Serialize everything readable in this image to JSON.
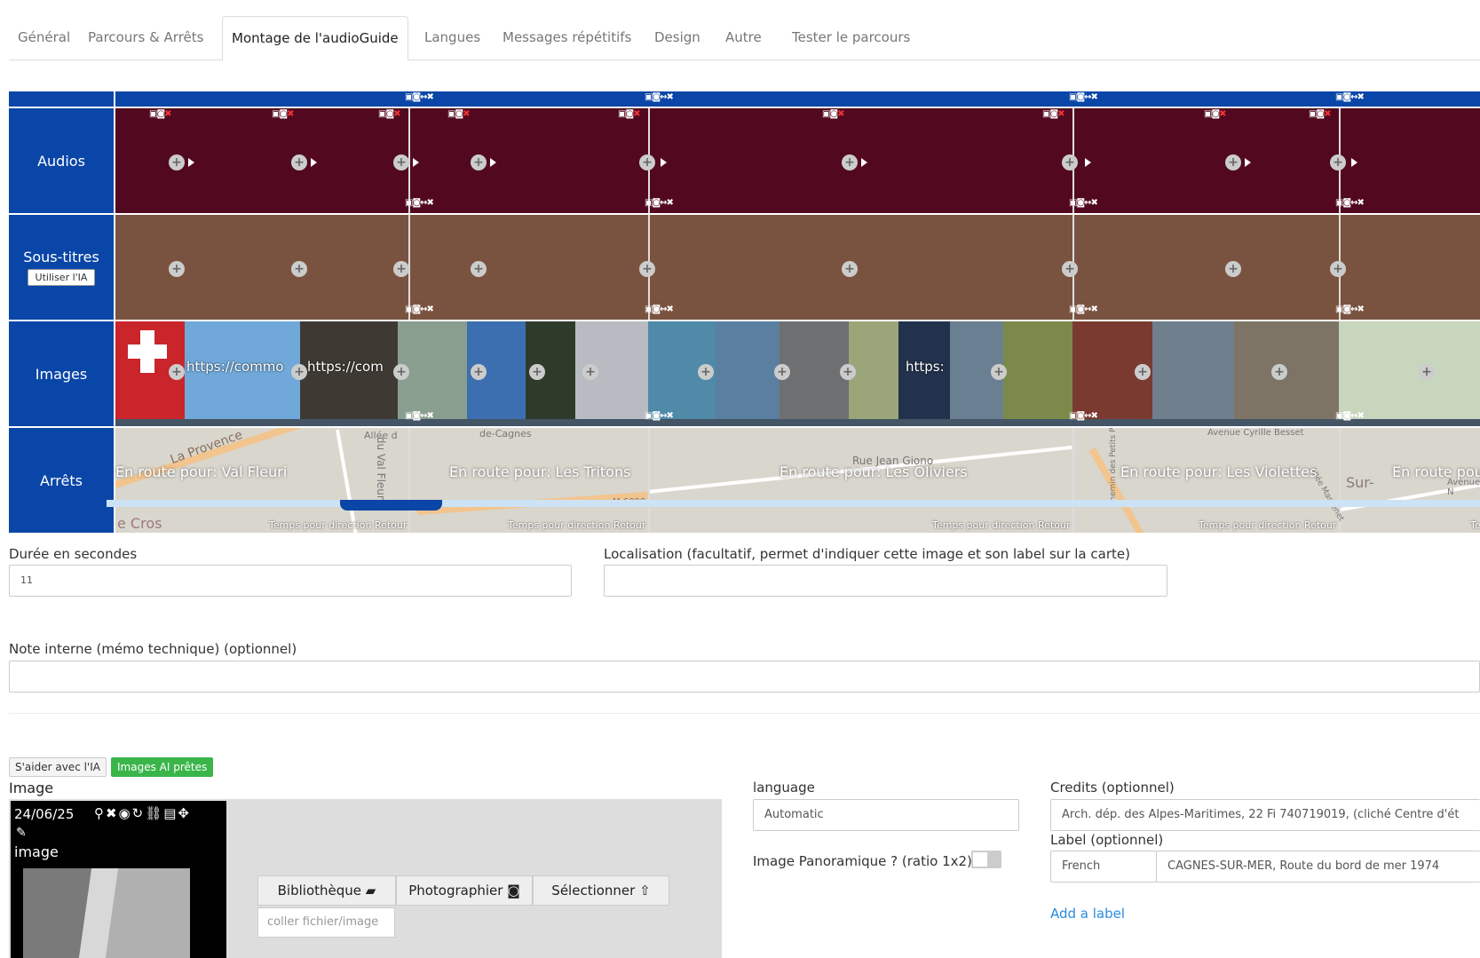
{
  "tabs": [
    {
      "label": "Général"
    },
    {
      "label": "Parcours & Arrêts"
    },
    {
      "label": "Montage de l'audioGuide"
    },
    {
      "label": "Langues"
    },
    {
      "label": "Messages répétitifs"
    },
    {
      "label": "Design"
    },
    {
      "label": "Autre"
    },
    {
      "label": "Tester le parcours"
    }
  ],
  "timeline": {
    "rows": {
      "audios": "Audios",
      "subtitles": "Sous-titres",
      "subtitles_ai_button": "Utiliser l'IA",
      "images": "Images",
      "stops": "Arrêts"
    },
    "image_urls": [
      "https://commo",
      "https://com",
      "https:"
    ],
    "stops": [
      {
        "name": "En route pour: Val Fleuri",
        "time": "Temps pour direction Retour"
      },
      {
        "name": "En route pour: Les Tritons",
        "time": "Temps pour direction Retour"
      },
      {
        "name": "En route pour: Les Oliviers",
        "time": "Temps pour direction Retour"
      },
      {
        "name": "En route pour: Les Violettes",
        "time": "Temps pour direction Retour"
      },
      {
        "name": "En route pour:",
        "time": "Ten"
      }
    ],
    "map_labels": [
      "La Provence",
      "Allée d",
      "du Val Fleuri",
      "e Cros",
      "de-Cagnes",
      "M 6098",
      "Rue Jean Giono",
      "Avenue Cyrille Besset",
      "Chemin des Petits Plans",
      "Allée Massenet",
      "Sur-",
      "Avenue N"
    ]
  },
  "form": {
    "duration_label": "Durée en secondes",
    "duration_value": "11",
    "location_label": "Localisation (facultatif, permet d'indiquer cette image et son label sur la carte)",
    "location_value": "",
    "note_label": "Note interne (mémo technique) (optionnel)",
    "note_value": ""
  },
  "image_section": {
    "ai_help_button": "S'aider avec l'IA",
    "ai_images_button": "Images AI prêtes",
    "image_label": "Image",
    "card_date": "24/06/25",
    "card_label": "image",
    "library_button": "Bibliothèque",
    "photo_button": "Photographier",
    "select_button": "Sélectionner",
    "paste_placeholder": "coller fichier/image",
    "language_label": "language",
    "language_value": "Automatic",
    "panoramic_label": "Image Panoramique ? (ratio 1x2)",
    "credits_label": "Credits (optionnel)",
    "credits_value": "Arch. dép. des Alpes-Maritimes, 22 Fi 740719019, (cliché Centre d'ét",
    "label_label": "Label (optionnel)",
    "label_lang": "French",
    "label_value": "CAGNES-SUR-MER, Route du bord de mer 1974",
    "add_label_link": "Add a label"
  },
  "colors": {
    "accent_blue": "#0a46a7",
    "audio_bg": "#52091f",
    "subtitle_bg": "#7a5340",
    "green": "#3ab54a",
    "link": "#2a8be0"
  }
}
